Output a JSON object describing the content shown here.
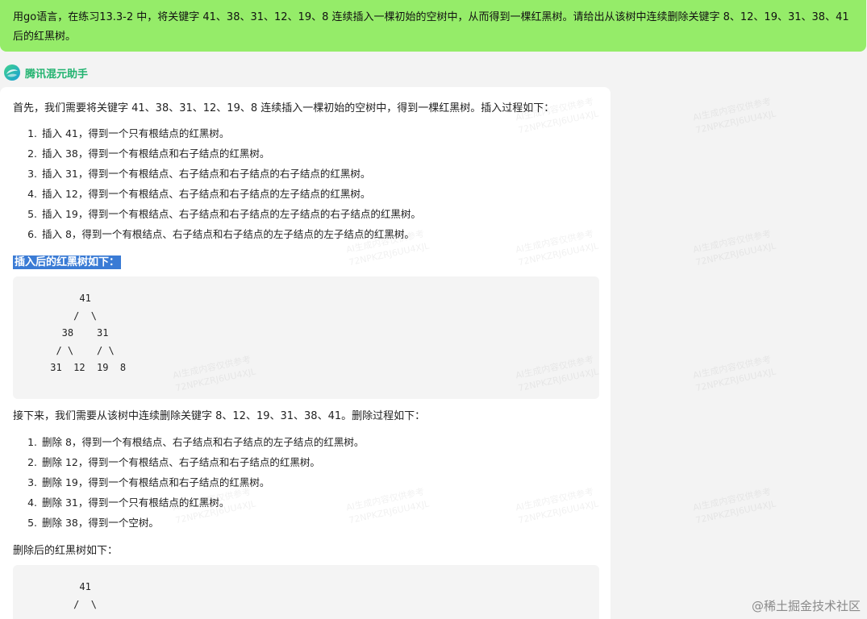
{
  "question": {
    "text": "用go语言，在练习13.3-2 中，将关键字 41、38、31、12、19、8 连续插入一棵初始的空树中，从而得到一棵红黑树。请给出从该树中连续删除关键字 8、12、19、31、38、41 后的红黑树。"
  },
  "assistant": {
    "name": "腾讯混元助手",
    "logo_icon": "hunyuan-logo-icon"
  },
  "answer": {
    "intro": "首先，我们需要将关键字 41、38、31、12、19、8 连续插入一棵初始的空树中，得到一棵红黑树。插入过程如下：",
    "insert_steps": [
      {
        "num": "1.",
        "text": "插入 41，得到一个只有根结点的红黑树。"
      },
      {
        "num": "2.",
        "text": "插入 38，得到一个有根结点和右子结点的红黑树。"
      },
      {
        "num": "3.",
        "text": "插入 31，得到一个有根结点、右子结点和右子结点的右子结点的红黑树。"
      },
      {
        "num": "4.",
        "text": "插入 12，得到一个有根结点、右子结点和右子结点的左子结点的红黑树。"
      },
      {
        "num": "5.",
        "text": "插入 19，得到一个有根结点、右子结点和右子结点的左子结点的右子结点的红黑树。"
      },
      {
        "num": "6.",
        "text": "插入 8，得到一个有根结点、右子结点和右子结点的左子结点的左子结点的红黑树。"
      }
    ],
    "after_insert_label": "插入后的红黑树如下：",
    "tree_after_insert": "      41\n     /  \\\n   38    31\n  / \\    / \\\n 31  12  19  8",
    "delete_intro": "接下来，我们需要从该树中连续删除关键字 8、12、19、31、38、41。删除过程如下：",
    "delete_steps": [
      {
        "num": "1.",
        "text": "删除 8，得到一个有根结点、右子结点和右子结点的左子结点的红黑树。"
      },
      {
        "num": "2.",
        "text": "删除 12，得到一个有根结点、右子结点和右子结点的红黑树。"
      },
      {
        "num": "3.",
        "text": "删除 19，得到一个有根结点和右子结点的红黑树。"
      },
      {
        "num": "4.",
        "text": "删除 31，得到一个只有根结点的红黑树。"
      },
      {
        "num": "5.",
        "text": "删除 38，得到一个空树。"
      }
    ],
    "after_delete_label": "删除后的红黑树如下：",
    "tree_after_delete": "      41\n     /  \\"
  },
  "watermark": {
    "line1": "AI生成内容仅供参考",
    "line2": "72NPKZRJ6UU4XJL"
  },
  "site": {
    "watermark": "@稀土掘金技术社区"
  }
}
